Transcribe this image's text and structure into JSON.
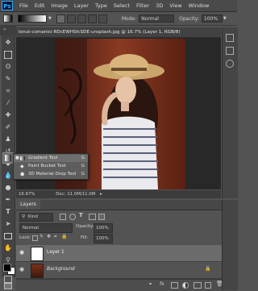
{
  "app": {
    "logo": "Ps"
  },
  "menu": [
    "File",
    "Edit",
    "Image",
    "Layer",
    "Type",
    "Select",
    "Filter",
    "3D",
    "View",
    "Window"
  ],
  "options_bar": {
    "mode_label": "Mode:",
    "mode_value": "Normal",
    "opacity_label": "Opacity:",
    "opacity_value": "100%"
  },
  "document": {
    "tab_title": "Ionut-comanici-RDcEWHSfcSDE-unsplash.jpg @ 16.7% (Layer 1, RGB/8)",
    "zoom": "16.67%",
    "doc_info": "Doc: 11.0M/11.0M"
  },
  "tool_flyout": [
    {
      "name": "Gradient Tool",
      "shortcut": "G"
    },
    {
      "name": "Paint Bucket Tool",
      "shortcut": "G"
    },
    {
      "name": "3D Material Drop Tool",
      "shortcut": "G"
    }
  ],
  "layers_panel": {
    "title": "Layers",
    "kind_label": "Kind",
    "blend_mode": "Normal",
    "opacity_label": "Opacity:",
    "opacity_value": "100%",
    "lock_label": "Lock:",
    "fill_label": "Fill:",
    "fill_value": "100%",
    "layers": [
      {
        "name": "Layer 1"
      },
      {
        "name": "Background"
      }
    ]
  },
  "bottom_icons": [
    "link-icon",
    "fx-icon",
    "mask-icon",
    "adjustment-icon",
    "group-icon",
    "new-layer-icon",
    "trash-icon"
  ]
}
